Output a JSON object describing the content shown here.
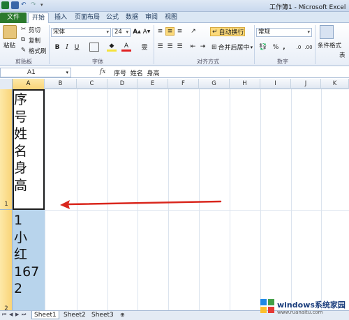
{
  "window": {
    "title": "工作簿1 - Microsoft Excel"
  },
  "tabs": [
    "文件",
    "开始",
    "插入",
    "页面布局",
    "公式",
    "数据",
    "审阅",
    "视图"
  ],
  "ribbon": {
    "clipboard": {
      "paste": "粘贴",
      "cut": "剪切",
      "copy": "复制",
      "format_painter": "格式刷",
      "label": "剪贴板"
    },
    "font": {
      "name": "宋体",
      "size": "24",
      "label": "字体"
    },
    "alignment": {
      "wrap_text": "自动换行",
      "merge_center": "合并后居中",
      "label": "对齐方式"
    },
    "number": {
      "format": "常规",
      "label": "数字"
    },
    "styles": {
      "conditional": "条件格式",
      "table": "表"
    }
  },
  "formula_bar": {
    "name_box": "A1",
    "fx": "fx",
    "content": "序号  姓名  身高"
  },
  "grid": {
    "columns": [
      "A",
      "B",
      "C",
      "D",
      "E",
      "F",
      "G",
      "H",
      "I",
      "J",
      "K"
    ],
    "rows": [
      "1",
      "2"
    ],
    "cells": {
      "A1": [
        "序",
        "号",
        "姓",
        "名",
        "身",
        "高"
      ],
      "A2": [
        "1",
        "小",
        "红",
        "167",
        "2"
      ]
    }
  },
  "sheets": [
    "Sheet1",
    "Sheet2",
    "Sheet3"
  ],
  "watermark": {
    "brand": "windows系统家园",
    "url": "www.ruanaitu.com"
  },
  "colors": {
    "file_tab": "#2b7a2d",
    "selection_header": "#f9d478",
    "selected_fill": "#b8d4ec",
    "arrow": "#d9261c"
  }
}
